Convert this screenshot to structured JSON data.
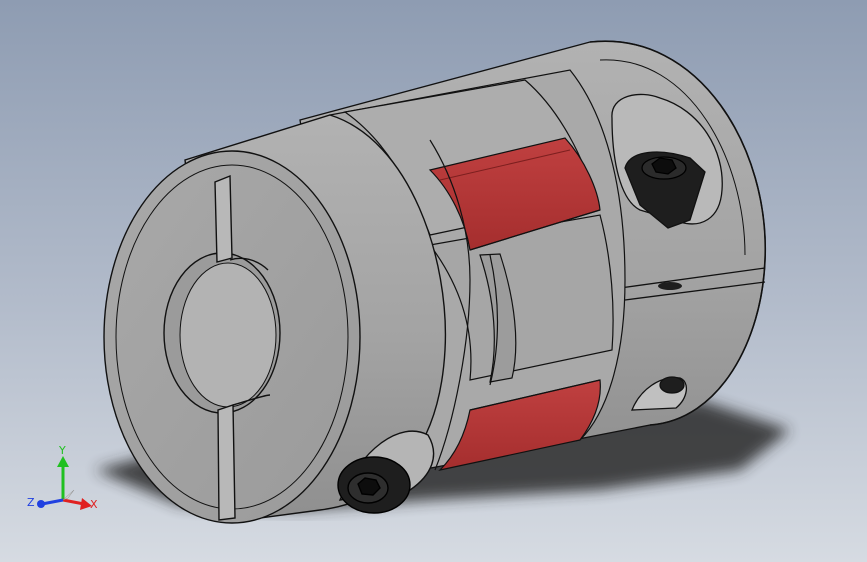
{
  "viewport": {
    "background_top": "#8e9cb2",
    "background_bottom": "#d6dbe2"
  },
  "model": {
    "body_color": "#a6a6a6",
    "body_dark": "#8e8e8e",
    "elastomer_color": "#b73838",
    "screw_color": "#1e1e1e",
    "shadow_color": "#2a2a2a"
  },
  "triad": {
    "x_label": "X",
    "y_label": "Y",
    "z_label": "Z",
    "x_color": "#e02020",
    "y_color": "#20c020",
    "z_color": "#2040e0"
  }
}
